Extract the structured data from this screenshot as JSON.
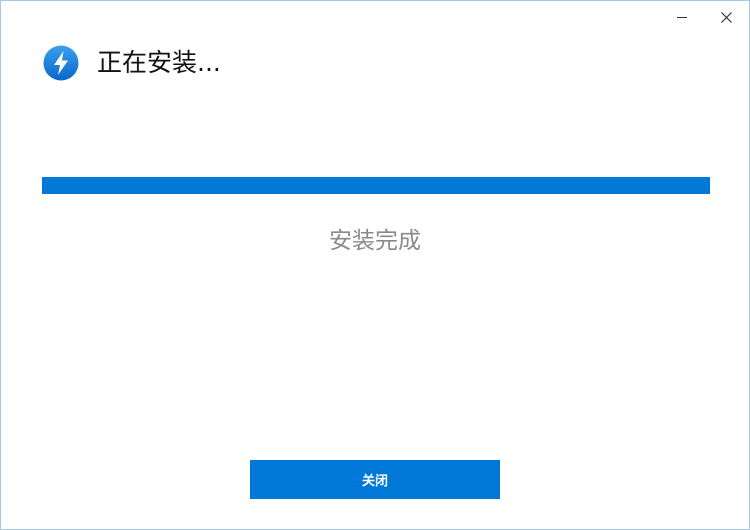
{
  "window": {
    "title": "正在安装...",
    "app_icon": "lightning-bolt-icon",
    "controls": {
      "minimize_icon": "minimize-icon",
      "close_icon": "close-icon"
    }
  },
  "progress": {
    "percent": 100,
    "color": "#0078d7"
  },
  "status": {
    "text": "安装完成"
  },
  "footer": {
    "close_label": "关闭",
    "button_color": "#0078d7"
  }
}
